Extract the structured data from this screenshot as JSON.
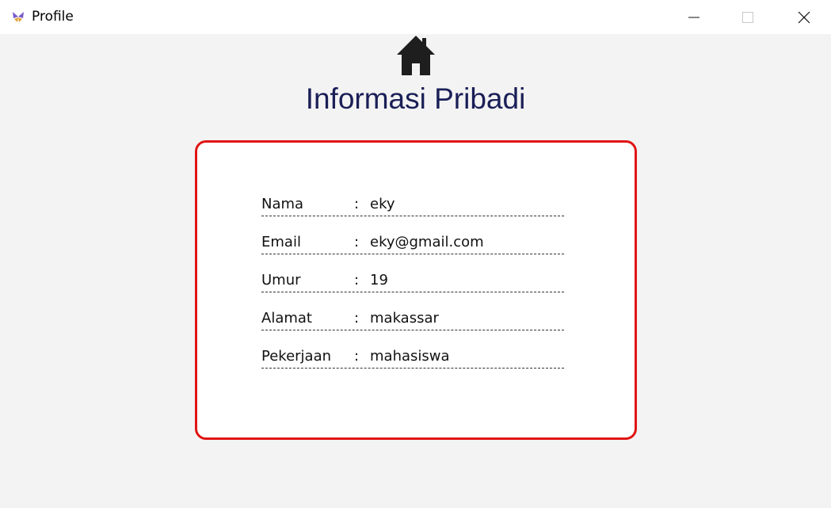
{
  "window": {
    "title": "Profile",
    "app_icon": "butterfly-logo-icon",
    "controls": [
      "minimize-icon",
      "maximize-icon",
      "close-icon"
    ]
  },
  "header": {
    "home_icon": "home-icon",
    "title": "Informasi Pribadi",
    "title_color": "#1a1f57"
  },
  "card": {
    "border_color": "#e01414",
    "separator": ":",
    "rows": [
      {
        "label": "Nama",
        "value": "eky"
      },
      {
        "label": "Email",
        "value": "eky@gmail.com"
      },
      {
        "label": "Umur",
        "value": "19"
      },
      {
        "label": "Alamat",
        "value": "makassar"
      },
      {
        "label": "Pekerjaan",
        "value": "mahasiswa"
      }
    ]
  }
}
